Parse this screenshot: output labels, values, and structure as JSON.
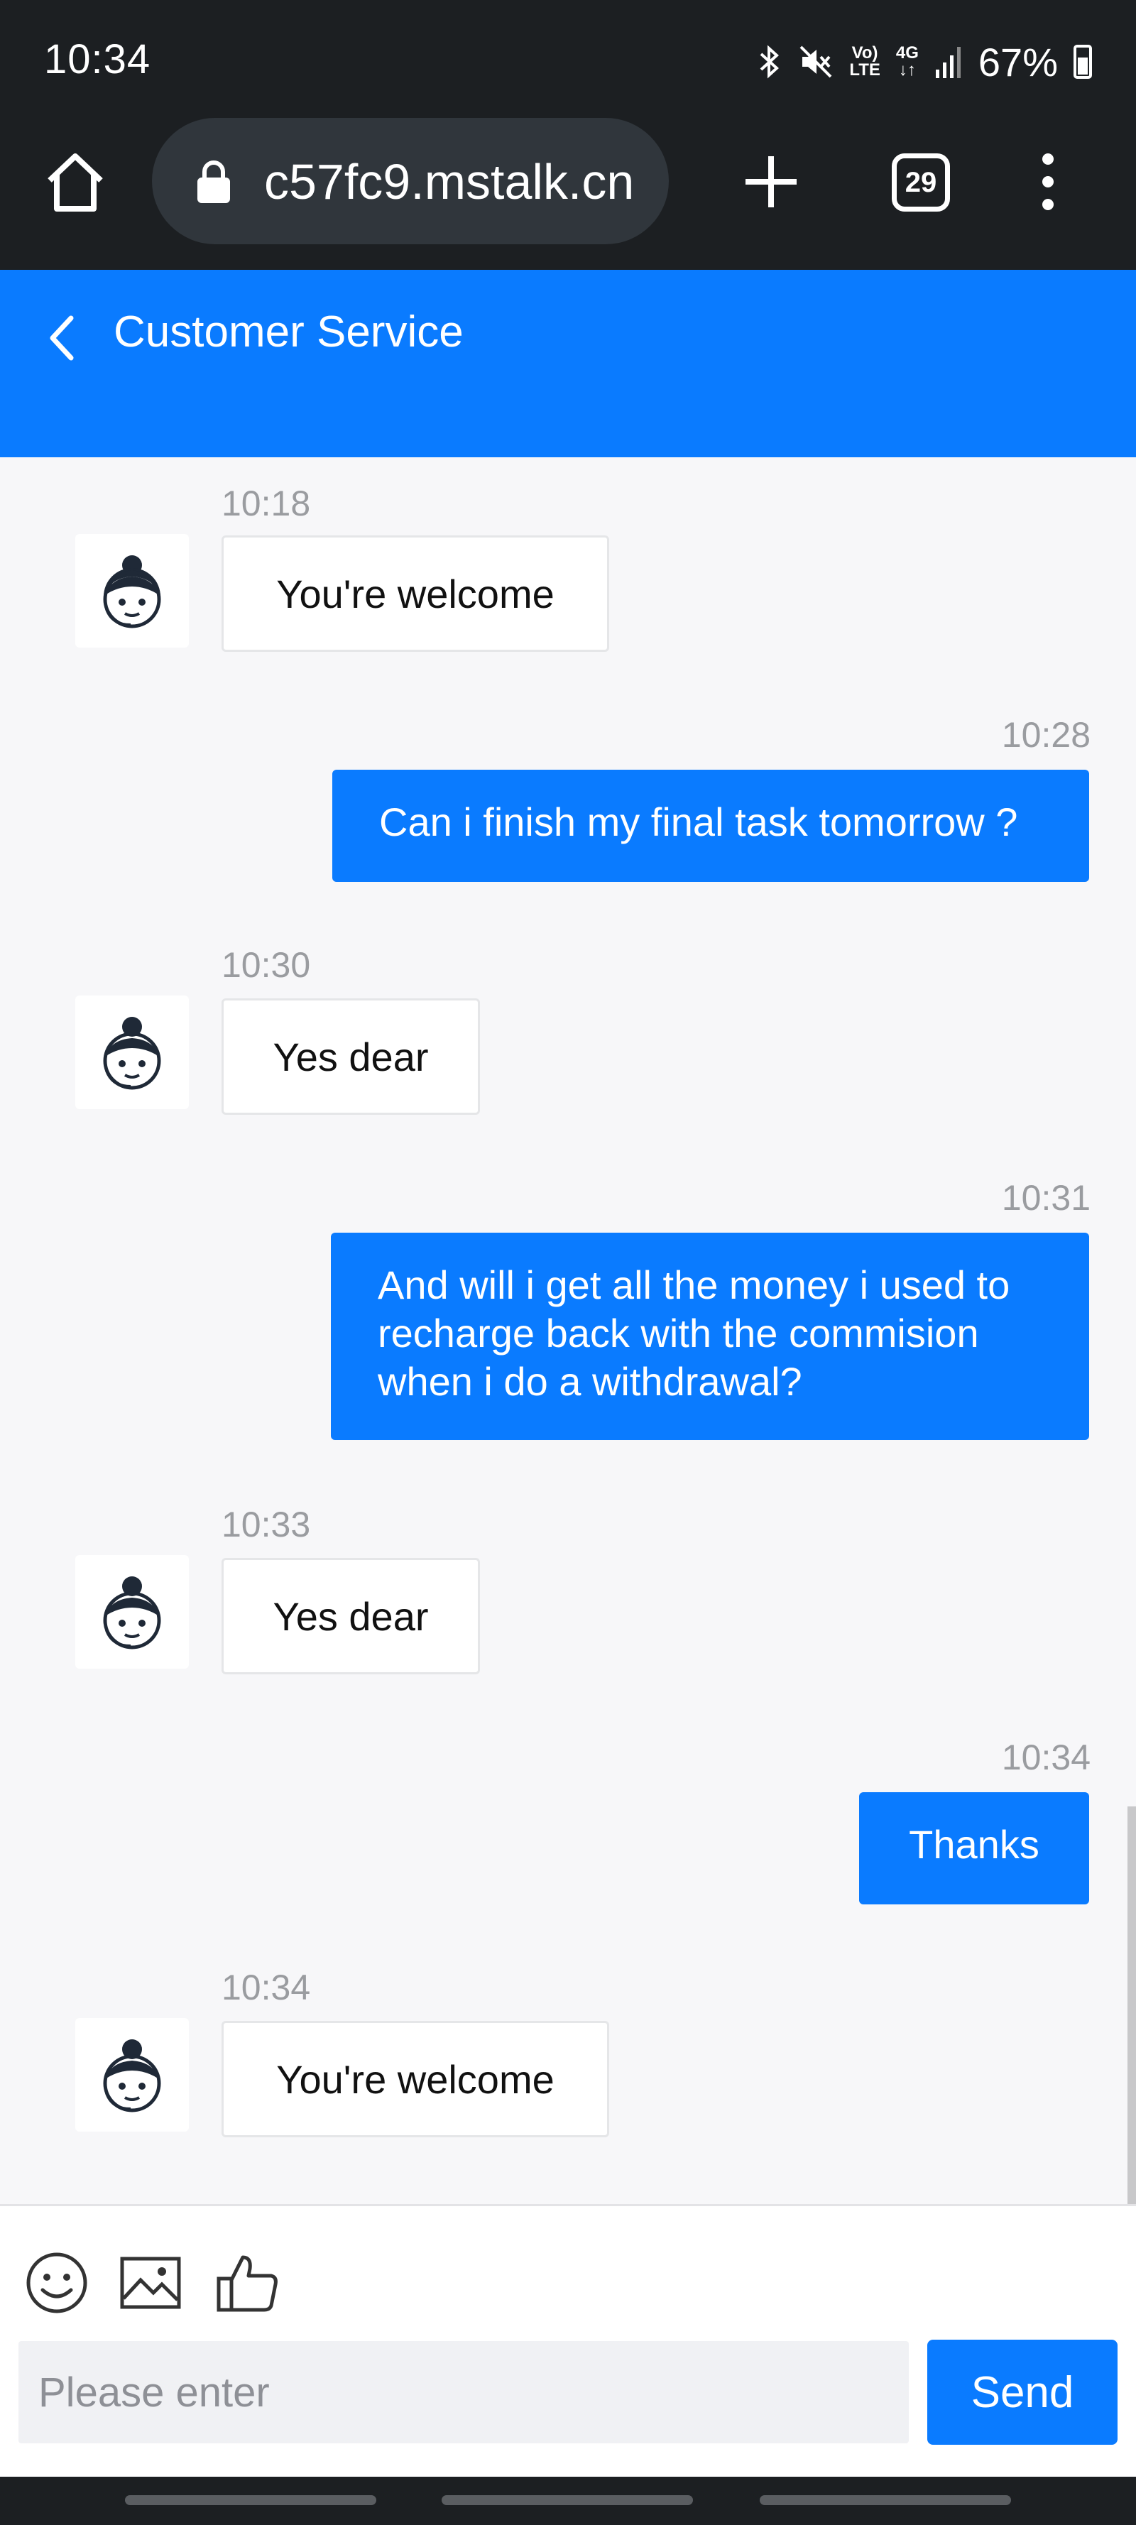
{
  "status": {
    "time": "10:34",
    "network_top": "Vo)",
    "network_bottom": "LTE",
    "data_top": "4G",
    "data_bottom": "↓↑",
    "battery": "67%",
    "icons": [
      "bluetooth-icon",
      "mute-icon",
      "signal-icon",
      "battery-icon"
    ]
  },
  "browser": {
    "url": "c57fc9.mstalk.cn",
    "tab_count": "29"
  },
  "header": {
    "title": "Customer Service"
  },
  "messages": [
    {
      "side": "in",
      "time": "10:18",
      "text": "You're welcome"
    },
    {
      "side": "out",
      "time": "10:28",
      "text": "Can i finish my final task tomorrow ?"
    },
    {
      "side": "in",
      "time": "10:30",
      "text": "Yes dear"
    },
    {
      "side": "out",
      "time": "10:31",
      "text": "And will i get all the money i used to recharge back with the commision when i do a withdrawal?"
    },
    {
      "side": "in",
      "time": "10:33",
      "text": "Yes dear"
    },
    {
      "side": "out",
      "time": "10:34",
      "text": "Thanks"
    },
    {
      "side": "in",
      "time": "10:34",
      "text": "You're welcome"
    }
  ],
  "composer": {
    "placeholder": "Please enter",
    "send_label": "Send",
    "tools": [
      "emoji-icon",
      "image-icon",
      "thumbs-up-icon"
    ]
  },
  "colors": {
    "accent": "#0a7bff",
    "chrome": "#1c1f22",
    "chat_bg": "#f7f7f9"
  }
}
